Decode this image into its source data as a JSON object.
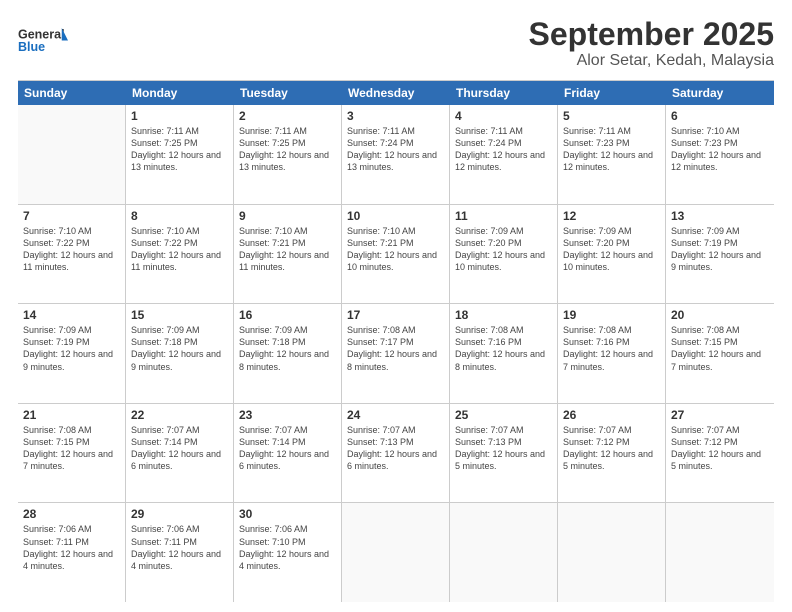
{
  "header": {
    "logo_general": "General",
    "logo_blue": "Blue",
    "month": "September 2025",
    "location": "Alor Setar, Kedah, Malaysia"
  },
  "weekdays": [
    "Sunday",
    "Monday",
    "Tuesday",
    "Wednesday",
    "Thursday",
    "Friday",
    "Saturday"
  ],
  "rows": [
    [
      {
        "day": "",
        "sunrise": "",
        "sunset": "",
        "daylight": ""
      },
      {
        "day": "1",
        "sunrise": "Sunrise: 7:11 AM",
        "sunset": "Sunset: 7:25 PM",
        "daylight": "Daylight: 12 hours and 13 minutes."
      },
      {
        "day": "2",
        "sunrise": "Sunrise: 7:11 AM",
        "sunset": "Sunset: 7:25 PM",
        "daylight": "Daylight: 12 hours and 13 minutes."
      },
      {
        "day": "3",
        "sunrise": "Sunrise: 7:11 AM",
        "sunset": "Sunset: 7:24 PM",
        "daylight": "Daylight: 12 hours and 13 minutes."
      },
      {
        "day": "4",
        "sunrise": "Sunrise: 7:11 AM",
        "sunset": "Sunset: 7:24 PM",
        "daylight": "Daylight: 12 hours and 12 minutes."
      },
      {
        "day": "5",
        "sunrise": "Sunrise: 7:11 AM",
        "sunset": "Sunset: 7:23 PM",
        "daylight": "Daylight: 12 hours and 12 minutes."
      },
      {
        "day": "6",
        "sunrise": "Sunrise: 7:10 AM",
        "sunset": "Sunset: 7:23 PM",
        "daylight": "Daylight: 12 hours and 12 minutes."
      }
    ],
    [
      {
        "day": "7",
        "sunrise": "Sunrise: 7:10 AM",
        "sunset": "Sunset: 7:22 PM",
        "daylight": "Daylight: 12 hours and 11 minutes."
      },
      {
        "day": "8",
        "sunrise": "Sunrise: 7:10 AM",
        "sunset": "Sunset: 7:22 PM",
        "daylight": "Daylight: 12 hours and 11 minutes."
      },
      {
        "day": "9",
        "sunrise": "Sunrise: 7:10 AM",
        "sunset": "Sunset: 7:21 PM",
        "daylight": "Daylight: 12 hours and 11 minutes."
      },
      {
        "day": "10",
        "sunrise": "Sunrise: 7:10 AM",
        "sunset": "Sunset: 7:21 PM",
        "daylight": "Daylight: 12 hours and 10 minutes."
      },
      {
        "day": "11",
        "sunrise": "Sunrise: 7:09 AM",
        "sunset": "Sunset: 7:20 PM",
        "daylight": "Daylight: 12 hours and 10 minutes."
      },
      {
        "day": "12",
        "sunrise": "Sunrise: 7:09 AM",
        "sunset": "Sunset: 7:20 PM",
        "daylight": "Daylight: 12 hours and 10 minutes."
      },
      {
        "day": "13",
        "sunrise": "Sunrise: 7:09 AM",
        "sunset": "Sunset: 7:19 PM",
        "daylight": "Daylight: 12 hours and 9 minutes."
      }
    ],
    [
      {
        "day": "14",
        "sunrise": "Sunrise: 7:09 AM",
        "sunset": "Sunset: 7:19 PM",
        "daylight": "Daylight: 12 hours and 9 minutes."
      },
      {
        "day": "15",
        "sunrise": "Sunrise: 7:09 AM",
        "sunset": "Sunset: 7:18 PM",
        "daylight": "Daylight: 12 hours and 9 minutes."
      },
      {
        "day": "16",
        "sunrise": "Sunrise: 7:09 AM",
        "sunset": "Sunset: 7:18 PM",
        "daylight": "Daylight: 12 hours and 8 minutes."
      },
      {
        "day": "17",
        "sunrise": "Sunrise: 7:08 AM",
        "sunset": "Sunset: 7:17 PM",
        "daylight": "Daylight: 12 hours and 8 minutes."
      },
      {
        "day": "18",
        "sunrise": "Sunrise: 7:08 AM",
        "sunset": "Sunset: 7:16 PM",
        "daylight": "Daylight: 12 hours and 8 minutes."
      },
      {
        "day": "19",
        "sunrise": "Sunrise: 7:08 AM",
        "sunset": "Sunset: 7:16 PM",
        "daylight": "Daylight: 12 hours and 7 minutes."
      },
      {
        "day": "20",
        "sunrise": "Sunrise: 7:08 AM",
        "sunset": "Sunset: 7:15 PM",
        "daylight": "Daylight: 12 hours and 7 minutes."
      }
    ],
    [
      {
        "day": "21",
        "sunrise": "Sunrise: 7:08 AM",
        "sunset": "Sunset: 7:15 PM",
        "daylight": "Daylight: 12 hours and 7 minutes."
      },
      {
        "day": "22",
        "sunrise": "Sunrise: 7:07 AM",
        "sunset": "Sunset: 7:14 PM",
        "daylight": "Daylight: 12 hours and 6 minutes."
      },
      {
        "day": "23",
        "sunrise": "Sunrise: 7:07 AM",
        "sunset": "Sunset: 7:14 PM",
        "daylight": "Daylight: 12 hours and 6 minutes."
      },
      {
        "day": "24",
        "sunrise": "Sunrise: 7:07 AM",
        "sunset": "Sunset: 7:13 PM",
        "daylight": "Daylight: 12 hours and 6 minutes."
      },
      {
        "day": "25",
        "sunrise": "Sunrise: 7:07 AM",
        "sunset": "Sunset: 7:13 PM",
        "daylight": "Daylight: 12 hours and 5 minutes."
      },
      {
        "day": "26",
        "sunrise": "Sunrise: 7:07 AM",
        "sunset": "Sunset: 7:12 PM",
        "daylight": "Daylight: 12 hours and 5 minutes."
      },
      {
        "day": "27",
        "sunrise": "Sunrise: 7:07 AM",
        "sunset": "Sunset: 7:12 PM",
        "daylight": "Daylight: 12 hours and 5 minutes."
      }
    ],
    [
      {
        "day": "28",
        "sunrise": "Sunrise: 7:06 AM",
        "sunset": "Sunset: 7:11 PM",
        "daylight": "Daylight: 12 hours and 4 minutes."
      },
      {
        "day": "29",
        "sunrise": "Sunrise: 7:06 AM",
        "sunset": "Sunset: 7:11 PM",
        "daylight": "Daylight: 12 hours and 4 minutes."
      },
      {
        "day": "30",
        "sunrise": "Sunrise: 7:06 AM",
        "sunset": "Sunset: 7:10 PM",
        "daylight": "Daylight: 12 hours and 4 minutes."
      },
      {
        "day": "",
        "sunrise": "",
        "sunset": "",
        "daylight": ""
      },
      {
        "day": "",
        "sunrise": "",
        "sunset": "",
        "daylight": ""
      },
      {
        "day": "",
        "sunrise": "",
        "sunset": "",
        "daylight": ""
      },
      {
        "day": "",
        "sunrise": "",
        "sunset": "",
        "daylight": ""
      }
    ]
  ]
}
